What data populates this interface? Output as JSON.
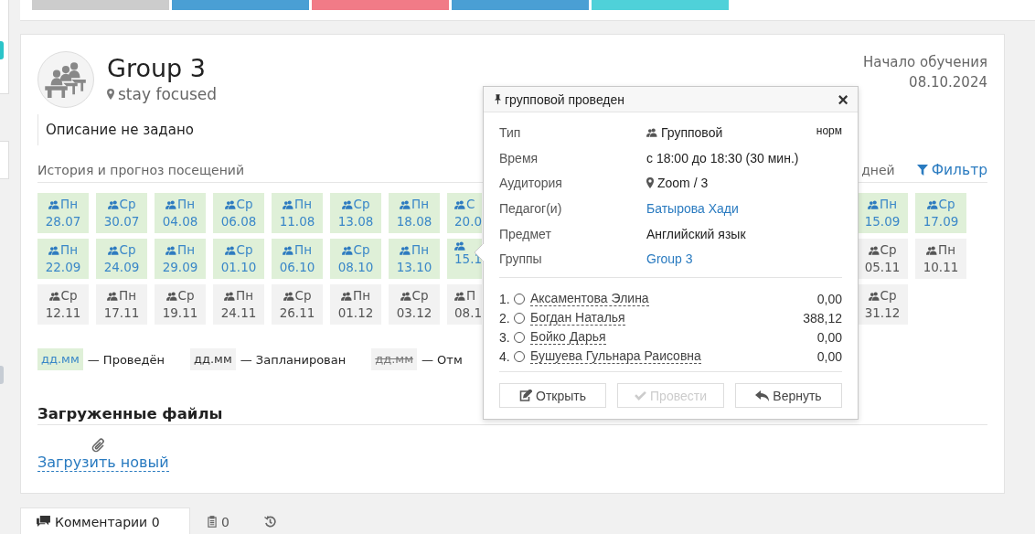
{
  "top_buttons": [
    {
      "color": "#cccccc"
    },
    {
      "color": "#4a9fd4"
    },
    {
      "color": "#f17b87"
    },
    {
      "color": "#4a9fd4"
    },
    {
      "color": "#4fd1d9"
    }
  ],
  "group": {
    "title": "Group 3",
    "location": "stay focused",
    "description": "Описание не задано",
    "start_label": "Начало обучения",
    "start_date": "08.10.2024"
  },
  "attendance": {
    "title": "История и прогноз посещений",
    "range_fragment": "дней",
    "filter": "Фильтр",
    "rows": [
      {
        "tiles": [
          {
            "day": "Пн",
            "date": "28.07",
            "done": true
          },
          {
            "day": "Ср",
            "date": "30.07",
            "done": true
          },
          {
            "day": "Пн",
            "date": "04.08",
            "done": true
          },
          {
            "day": "Ср",
            "date": "06.08",
            "done": true
          },
          {
            "day": "Пн",
            "date": "11.08",
            "done": true
          },
          {
            "day": "Ср",
            "date": "13.08",
            "done": true
          },
          {
            "day": "Пн",
            "date": "18.08",
            "done": true
          },
          {
            "day": "С",
            "date": "20.0",
            "done": true
          }
        ],
        "right_tiles": [
          {
            "day": "Пн",
            "date": "15.09",
            "done": true
          },
          {
            "day": "Ср",
            "date": "17.09",
            "done": true
          }
        ]
      },
      {
        "tiles": [
          {
            "day": "Пн",
            "date": "22.09",
            "done": true
          },
          {
            "day": "Ср",
            "date": "24.09",
            "done": true
          },
          {
            "day": "Пн",
            "date": "29.09",
            "done": true
          },
          {
            "day": "Ср",
            "date": "01.10",
            "done": true
          },
          {
            "day": "Пн",
            "date": "06.10",
            "done": true
          },
          {
            "day": "Ср",
            "date": "08.10",
            "done": true
          },
          {
            "day": "Пн",
            "date": "13.10",
            "done": true
          },
          {
            "date": "15.1",
            "done": true
          }
        ],
        "right_tiles": [
          {
            "day": "Ср",
            "date": "05.11",
            "done": false
          },
          {
            "day": "Пн",
            "date": "10.11",
            "done": false
          }
        ]
      },
      {
        "tiles": [
          {
            "day": "Ср",
            "date": "12.11",
            "done": false
          },
          {
            "day": "Пн",
            "date": "17.11",
            "done": false
          },
          {
            "day": "Ср",
            "date": "19.11",
            "done": false
          },
          {
            "day": "Пн",
            "date": "24.11",
            "done": false
          },
          {
            "day": "Ср",
            "date": "26.11",
            "done": false
          },
          {
            "day": "Пн",
            "date": "01.12",
            "done": false
          },
          {
            "day": "Ср",
            "date": "03.12",
            "done": false
          },
          {
            "day": "П",
            "date": "08.1",
            "done": false
          }
        ],
        "right_tiles": [
          {
            "day": "Ср",
            "date": "31.12",
            "done": false
          }
        ]
      }
    ],
    "legend": [
      {
        "sample": "дд.мм",
        "kind": "done",
        "label": "— Проведён"
      },
      {
        "sample": "дд.мм",
        "kind": "planned",
        "label": "— Запланирован"
      },
      {
        "sample": "дд.мм",
        "kind": "cancelled",
        "label": "— Отм"
      }
    ]
  },
  "files": {
    "title": "Загруженные файлы",
    "upload": "Загрузить новый"
  },
  "bottom_tabs": [
    {
      "kind": "comments",
      "label": "Комментарии 0",
      "selected": true
    },
    {
      "kind": "notes",
      "label": "0",
      "selected": false
    },
    {
      "kind": "history",
      "selected": false
    }
  ],
  "popup": {
    "title": "групповой проведен",
    "close": "×",
    "fields": [
      {
        "label": "Тип",
        "value": "Групповой",
        "kind": "people",
        "link": false,
        "badge": "норм"
      },
      {
        "label": "Время",
        "value": "с 18:00 до 18:30 (30 мин.)",
        "kind": "plain",
        "link": false
      },
      {
        "label": "Аудитория",
        "value": "Zoom / 3",
        "kind": "place",
        "link": false
      },
      {
        "label": "Педагог(и)",
        "value": "Батырова Хади",
        "kind": "plain",
        "link": true
      },
      {
        "label": "Предмет",
        "value": "Английский язык",
        "kind": "plain",
        "link": false
      },
      {
        "label": "Группы",
        "value": "Group 3",
        "kind": "plain",
        "link": true
      }
    ],
    "students": [
      {
        "number": "1.",
        "name": "Аксаментова Элина",
        "amount": "0,00",
        "selected": false
      },
      {
        "number": "2.",
        "name": "Богдан Наталья",
        "amount": "388,12",
        "selected": false
      },
      {
        "number": "3.",
        "name": "Бойко Дарья",
        "amount": "0,00",
        "selected": false
      },
      {
        "number": "4.",
        "name": "Бушуева Гульнара Раисовна",
        "amount": "0,00",
        "selected": false
      }
    ],
    "buttons": [
      {
        "kind": "open",
        "label": "Открыть",
        "disabled": false
      },
      {
        "kind": "conduct",
        "label": "Провести",
        "disabled": true
      },
      {
        "kind": "return",
        "label": "Вернуть",
        "disabled": false
      }
    ]
  }
}
